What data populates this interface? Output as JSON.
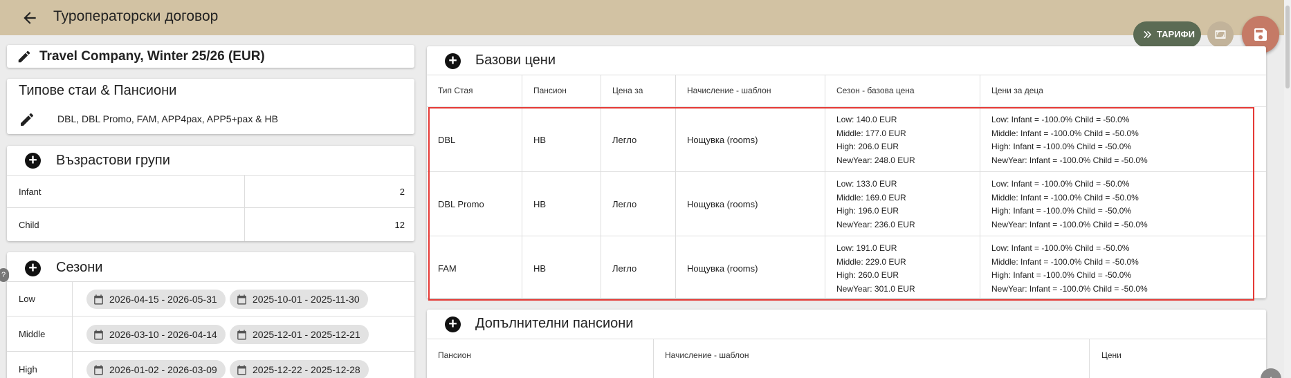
{
  "header": {
    "title": "Туроператорски договор"
  },
  "actions": {
    "tariffs_label": "ТАРИФИ"
  },
  "contract": {
    "name": "Travel Company, Winter 25/26 (EUR)"
  },
  "rooms": {
    "title": "Типове стаи & Пансиони",
    "summary": "DBL, DBL Promo, FAM, APP4pax, APP5+pax & HB"
  },
  "age_groups": {
    "title": "Възрастови групи",
    "rows": [
      {
        "label": "Infant",
        "value": "2"
      },
      {
        "label": "Child",
        "value": "12"
      }
    ]
  },
  "seasons": {
    "title": "Сезони",
    "rows": [
      {
        "label": "Low",
        "ranges": [
          "2026-04-15 - 2026-05-31",
          "2025-10-01 - 2025-11-30"
        ]
      },
      {
        "label": "Middle",
        "ranges": [
          "2026-03-10 - 2026-04-14",
          "2025-12-01 - 2025-12-21"
        ]
      },
      {
        "label": "High",
        "ranges": [
          "2026-01-02 - 2026-03-09",
          "2025-12-22 - 2025-12-28"
        ]
      }
    ]
  },
  "base_prices": {
    "title": "Базови цени",
    "headers": [
      "Тип Стая",
      "Пансион",
      "Цена за",
      "Начисление - шаблон",
      "Сезон - базова цена",
      "Цени за деца"
    ],
    "rows": [
      {
        "room": "DBL",
        "board": "HB",
        "per": "Легло",
        "template": "Нощувка (rooms)",
        "season_prices": [
          "Low:    140.0 EUR",
          "Middle:    177.0 EUR",
          "High:    206.0 EUR",
          "NewYear:    248.0 EUR"
        ],
        "child_prices": [
          "Low:    Infant = -100.0%    Child = -50.0%",
          "Middle:    Infant = -100.0%    Child = -50.0%",
          "High:    Infant = -100.0%    Child = -50.0%",
          "NewYear:    Infant = -100.0%    Child = -50.0%"
        ]
      },
      {
        "room": "DBL Promo",
        "board": "HB",
        "per": "Легло",
        "template": "Нощувка (rooms)",
        "season_prices": [
          "Low:    133.0 EUR",
          "Middle:    169.0 EUR",
          "High:    196.0 EUR",
          "NewYear:    236.0 EUR"
        ],
        "child_prices": [
          "Low:    Infant = -100.0%    Child = -50.0%",
          "Middle:    Infant = -100.0%    Child = -50.0%",
          "High:    Infant = -100.0%    Child = -50.0%",
          "NewYear:    Infant = -100.0%    Child = -50.0%"
        ]
      },
      {
        "room": "FAM",
        "board": "HB",
        "per": "Легло",
        "template": "Нощувка (rooms)",
        "season_prices": [
          "Low:    191.0 EUR",
          "Middle:    229.0 EUR",
          "High:    260.0 EUR",
          "NewYear:    301.0 EUR"
        ],
        "child_prices": [
          "Low:    Infant = -100.0%    Child = -50.0%",
          "Middle:    Infant = -100.0%    Child = -50.0%",
          "High:    Infant = -100.0%    Child = -50.0%",
          "NewYear:    Infant = -100.0%    Child = -50.0%"
        ]
      }
    ]
  },
  "extra_boards": {
    "title": "Допълнителни пансиони",
    "headers": [
      "Пансион",
      "Начисление - шаблон",
      "Цени"
    ]
  },
  "colors": {
    "topbar": "#d2c2a3",
    "tariffs_button": "#5b6b54",
    "save_button": "#c57a66",
    "highlight": "#e53935"
  }
}
